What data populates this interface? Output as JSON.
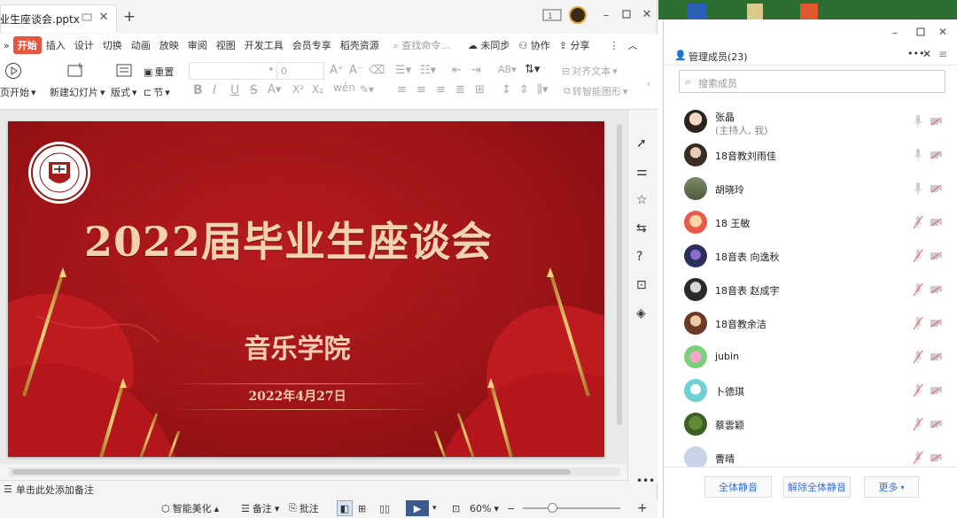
{
  "wps": {
    "tab_title": "业生座谈会.pptx",
    "menu": [
      "开始",
      "插入",
      "设计",
      "切换",
      "动画",
      "放映",
      "审阅",
      "视图",
      "开发工具",
      "会员专享",
      "稻壳资源"
    ],
    "search_placeholder": "查找命令...",
    "sync": "未同步",
    "collab": "协作",
    "share": "分享",
    "ribbon": {
      "from_start": "页开始",
      "new_slide": "新建幻灯片",
      "layout": "版式",
      "section": "节",
      "reset": "重置",
      "font_size": "0",
      "align_text": "对齐文本",
      "smart_shape": "转智能图形"
    },
    "notes_placeholder": "单击此处添加备注",
    "status": {
      "beautify": "智能美化",
      "notes": "备注",
      "comment": "批注",
      "zoom": "60%"
    }
  },
  "slide": {
    "title": "2022届毕业生座谈会",
    "subtitle": "音乐学院",
    "date": "2022年4月27日"
  },
  "panel": {
    "header": "管理成员(23)",
    "search_placeholder": "搜索成员",
    "members": [
      {
        "name": "张晶",
        "note": "(主持人, 我)",
        "muted": false
      },
      {
        "name": "18音教刘雨佳",
        "muted": false
      },
      {
        "name": "胡晓玲",
        "muted": false
      },
      {
        "name": "18 王敏",
        "muted": true
      },
      {
        "name": "18音表 向逸秋",
        "muted": true
      },
      {
        "name": "18音表 赵成宇",
        "muted": true
      },
      {
        "name": "18音教余洁",
        "muted": true
      },
      {
        "name": "jubin",
        "muted": true
      },
      {
        "name": "卜德琪",
        "muted": true
      },
      {
        "name": "蔡雲颖",
        "muted": true
      },
      {
        "name": "曹晴",
        "muted": true
      }
    ],
    "buttons": {
      "mute_all": "全体静音",
      "unmute_all": "解除全体静音",
      "more": "更多"
    }
  }
}
